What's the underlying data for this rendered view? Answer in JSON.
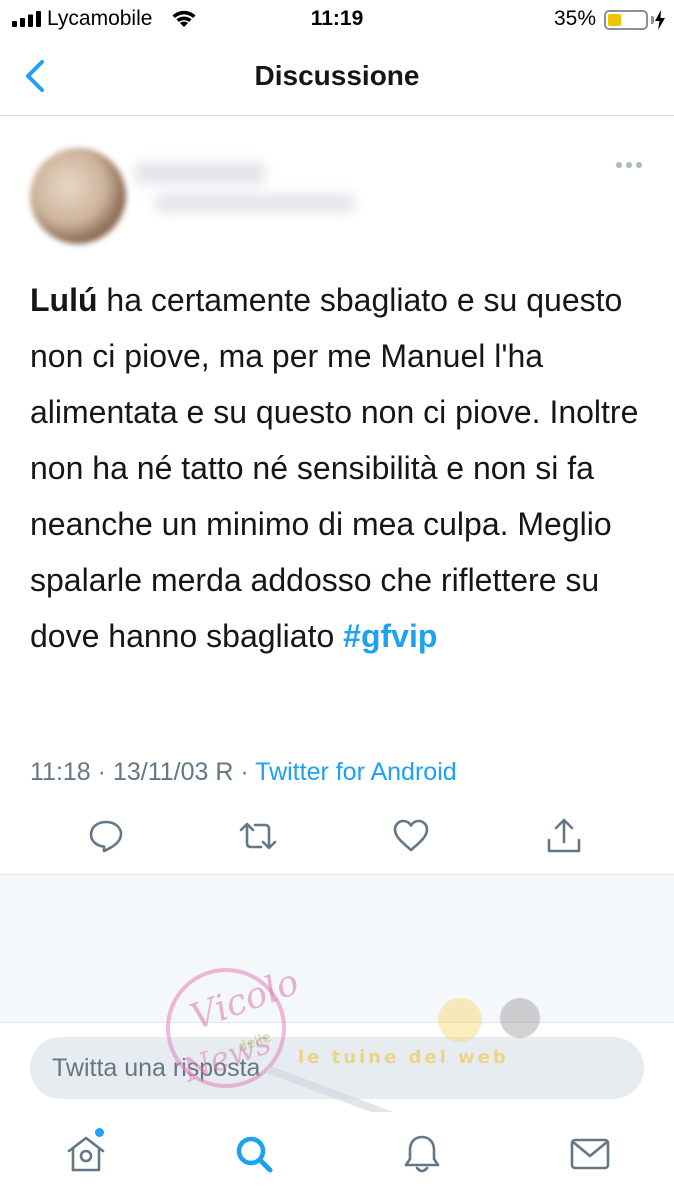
{
  "status_bar": {
    "carrier": "Lycamobile",
    "time": "11:19",
    "battery_percent": "35%",
    "battery_level": 0.35,
    "icons": [
      "signal-bars-icon",
      "wifi-icon",
      "battery-icon",
      "charging-bolt-icon"
    ]
  },
  "header": {
    "title": "Discussione",
    "back_icon": "chevron-left-icon"
  },
  "tweet": {
    "author_name": "",
    "author_handle": "",
    "text_bold": "Lulú",
    "text_body": " ha certamente sbagliato e su questo non ci piove, ma per me Manuel l'ha alimentata e su questo non ci piove. Inoltre non ha né tatto né sensibilità e non si fa neanche un minimo di mea culpa. Meglio spalarle merda addosso che riflettere su dove hanno sbagliato ",
    "hashtag": "#gfvip",
    "time": "11:18",
    "date": "13/11/03 R",
    "separator": " · ",
    "source": "Twitter for Android",
    "more_icon": "more-horizontal-icon",
    "actions": [
      "reply-icon",
      "retweet-icon",
      "like-icon",
      "share-icon"
    ]
  },
  "reply": {
    "placeholder": "Twitta una risposta"
  },
  "watermark": {
    "text_1": "Vicolo",
    "text_2": "delle",
    "text_3": "News",
    "text_4": "le tuine del web"
  },
  "tab_bar": {
    "items": [
      "home-icon",
      "search-icon",
      "notifications-icon",
      "messages-icon"
    ],
    "active": "search-icon"
  },
  "colors": {
    "accent": "#1da1f2",
    "text": "#14171a",
    "secondary": "#657786",
    "battery": "#f2c400"
  }
}
